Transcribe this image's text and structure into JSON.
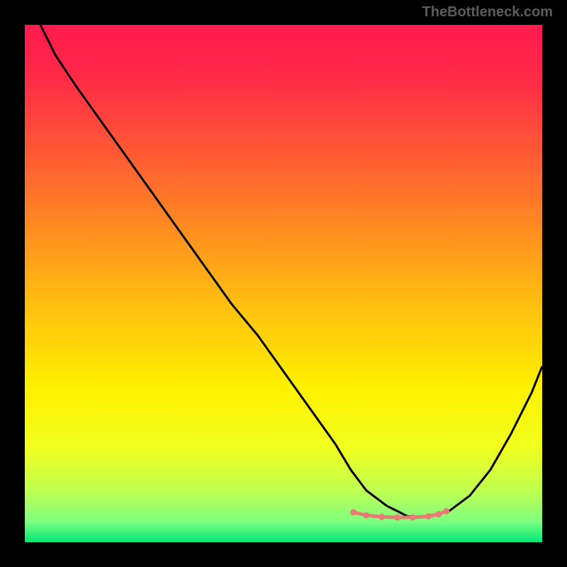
{
  "watermark": "TheBottleneck.com",
  "chart_data": {
    "type": "line",
    "title": "",
    "xlabel": "",
    "ylabel": "",
    "xlim": [
      0,
      100
    ],
    "ylim": [
      0,
      100
    ],
    "gradient_stops": [
      {
        "offset": 0.0,
        "color": "#ff1a4f"
      },
      {
        "offset": 0.1,
        "color": "#ff2a48"
      },
      {
        "offset": 0.25,
        "color": "#ff5a34"
      },
      {
        "offset": 0.4,
        "color": "#ff8e20"
      },
      {
        "offset": 0.55,
        "color": "#ffc210"
      },
      {
        "offset": 0.7,
        "color": "#fff000"
      },
      {
        "offset": 0.82,
        "color": "#f0ff20"
      },
      {
        "offset": 0.9,
        "color": "#c0ff50"
      },
      {
        "offset": 0.96,
        "color": "#80ff80"
      },
      {
        "offset": 1.0,
        "color": "#00e878"
      }
    ],
    "series": [
      {
        "name": "bottleneck-curve",
        "color": "#000000",
        "x": [
          3,
          6,
          10,
          15,
          20,
          25,
          30,
          35,
          40,
          45,
          50,
          55,
          60,
          63,
          66,
          70,
          74,
          78,
          82,
          86,
          90,
          94,
          98,
          100
        ],
        "values": [
          100,
          94,
          88,
          81,
          74,
          67,
          60,
          53,
          46,
          40,
          33,
          26,
          19,
          14,
          10,
          7,
          5,
          5,
          6,
          9,
          14,
          21,
          29,
          34
        ]
      }
    ],
    "markers": {
      "name": "highlight-dots",
      "color": "#e97a74",
      "x": [
        63.5,
        66,
        69,
        72,
        75,
        78,
        80,
        81.5
      ],
      "values": [
        5.8,
        5.2,
        4.9,
        4.8,
        4.8,
        5.0,
        5.4,
        6.0
      ]
    }
  }
}
